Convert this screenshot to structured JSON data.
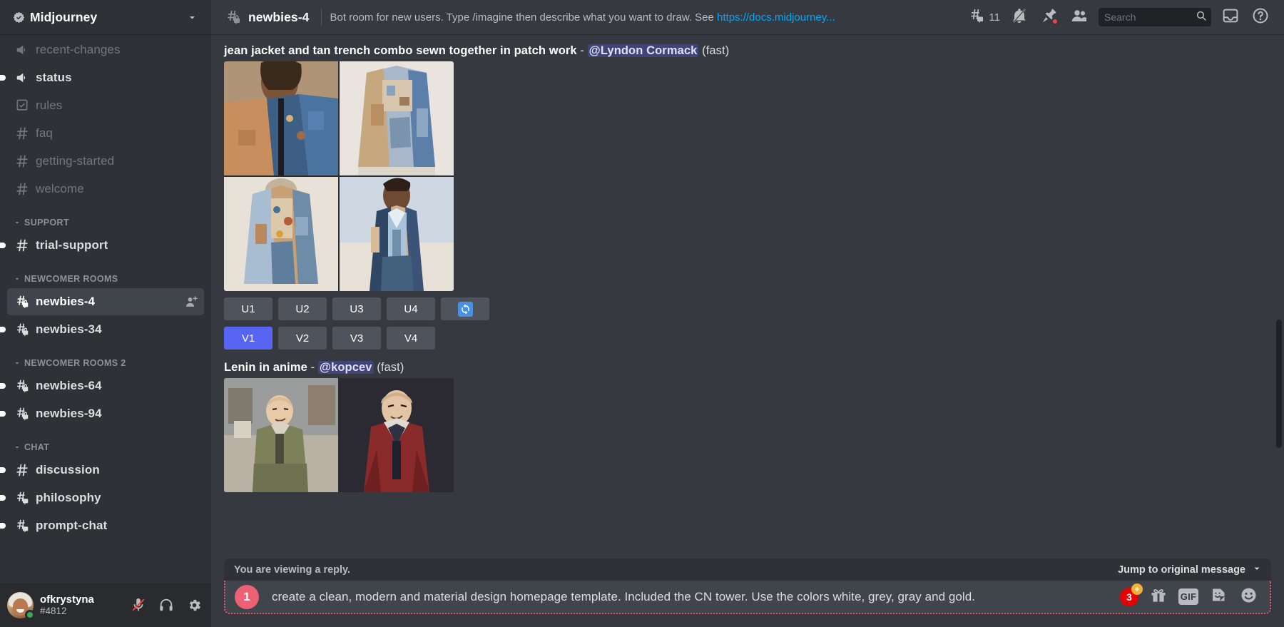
{
  "server": {
    "name": "Midjourney",
    "verified_icon": "verified-check-icon",
    "dropdown_icon": "chevron-down-icon"
  },
  "sidebar": {
    "groups": [
      {
        "label": null,
        "channels": [
          {
            "name": "recent-changes",
            "icon": "announcement-icon",
            "state": "muted",
            "unread": false
          },
          {
            "name": "status",
            "icon": "announcement-icon",
            "state": "unread",
            "unread": true
          },
          {
            "name": "rules",
            "icon": "rules-icon",
            "state": "muted",
            "unread": false
          },
          {
            "name": "faq",
            "icon": "hash-icon",
            "state": "muted",
            "unread": false
          },
          {
            "name": "getting-started",
            "icon": "hash-icon",
            "state": "muted",
            "unread": false
          },
          {
            "name": "welcome",
            "icon": "hash-icon",
            "state": "muted",
            "unread": false
          }
        ]
      },
      {
        "label": "SUPPORT",
        "channels": [
          {
            "name": "trial-support",
            "icon": "hash-icon",
            "state": "unread",
            "unread": true
          }
        ]
      },
      {
        "label": "NEWCOMER ROOMS",
        "channels": [
          {
            "name": "newbies-4",
            "icon": "hash-thread-lock-icon",
            "state": "active",
            "unread": false,
            "trailing_icon": "add-member-icon"
          },
          {
            "name": "newbies-34",
            "icon": "hash-thread-lock-icon",
            "state": "unread",
            "unread": true
          }
        ]
      },
      {
        "label": "NEWCOMER ROOMS 2",
        "channels": [
          {
            "name": "newbies-64",
            "icon": "hash-thread-lock-icon",
            "state": "unread",
            "unread": true
          },
          {
            "name": "newbies-94",
            "icon": "hash-thread-lock-icon",
            "state": "unread",
            "unread": true
          }
        ]
      },
      {
        "label": "CHAT",
        "channels": [
          {
            "name": "discussion",
            "icon": "hash-icon",
            "state": "unread",
            "unread": true
          },
          {
            "name": "philosophy",
            "icon": "hash-thread-icon",
            "state": "unread",
            "unread": true
          },
          {
            "name": "prompt-chat",
            "icon": "hash-thread-icon",
            "state": "unread",
            "unread": true
          }
        ]
      }
    ]
  },
  "user_panel": {
    "username": "ofkrystyna",
    "discriminator": "#4812",
    "status": "online",
    "controls": [
      {
        "name": "mute-microphone-button",
        "icon": "microphone-muted-icon"
      },
      {
        "name": "deafen-button",
        "icon": "headphones-icon"
      },
      {
        "name": "user-settings-button",
        "icon": "gear-icon"
      }
    ]
  },
  "topbar": {
    "channel_name": "newbies-4",
    "channel_icon": "hash-thread-lock-icon",
    "topic_prefix": "Bot room for new users. Type /imagine then describe what you want to draw. See ",
    "topic_link": "https://docs.midjourney...",
    "threads_count": "11",
    "actions": [
      {
        "name": "threads-button",
        "icon": "threads-icon",
        "count": "11"
      },
      {
        "name": "notification-settings-button",
        "icon": "bell-muted-icon"
      },
      {
        "name": "pinned-messages-button",
        "icon": "pin-icon",
        "has_dot": true
      },
      {
        "name": "member-list-button",
        "icon": "members-icon"
      },
      {
        "name": "inbox-button",
        "icon": "inbox-icon"
      },
      {
        "name": "help-button",
        "icon": "help-circle-icon"
      }
    ],
    "search": {
      "placeholder": "Search",
      "value": "",
      "icon": "search-icon"
    }
  },
  "messages": [
    {
      "prompt": "jean jacket and tan trench combo sewn together in patch work",
      "separator": "-",
      "author": "@Lyndon Cormack",
      "mode": "(fast)",
      "upscale_buttons": [
        "U1",
        "U2",
        "U3",
        "U4"
      ],
      "variation_buttons": [
        "V1",
        "V2",
        "V3",
        "V4"
      ],
      "reroll_icon": "refresh-emoji",
      "active_variation": "V1"
    },
    {
      "prompt": "Lenin in anime",
      "separator": "-",
      "author": "@kopcev",
      "mode": "(fast)"
    }
  ],
  "reply_bar": {
    "label": "You are viewing a reply.",
    "jump_label": "Jump to original message",
    "jump_icon": "chevron-down-icon"
  },
  "composer": {
    "badge_number": "1",
    "text_parts": [
      {
        "text": "create a clean, modern ",
        "error": false
      },
      {
        "text": "and",
        "error": true
      },
      {
        "text": " material design homepage template. ",
        "error": false
      },
      {
        "text": "Included",
        "error": true
      },
      {
        "text": " the CN tower. Use the colors white, grey, gray ",
        "error": false
      },
      {
        "text": "and",
        "error": true
      },
      {
        "text": " gold.",
        "error": false
      }
    ],
    "full_text": "create a clean, modern and material design homepage template. Included the CN tower. Use the colors white, grey, gray and gold.",
    "grammar_count": "3",
    "grammar_plus": "+",
    "actions": [
      {
        "name": "gift-button",
        "icon": "gift-icon"
      },
      {
        "name": "gif-button",
        "icon": "gif-icon",
        "label": "GIF"
      },
      {
        "name": "sticker-button",
        "icon": "sticker-icon"
      },
      {
        "name": "emoji-button",
        "icon": "emoji-smile-icon"
      }
    ]
  },
  "colors": {
    "accent_blurple": "#5865f2",
    "link_blue": "#00a8fc",
    "error_pink": "#ec6174",
    "grammar_red": "#e60000",
    "grammar_orange": "#f5b335",
    "online_green": "#3ba55c",
    "sidebar_bg": "#2f3136",
    "main_bg": "#36393f"
  }
}
